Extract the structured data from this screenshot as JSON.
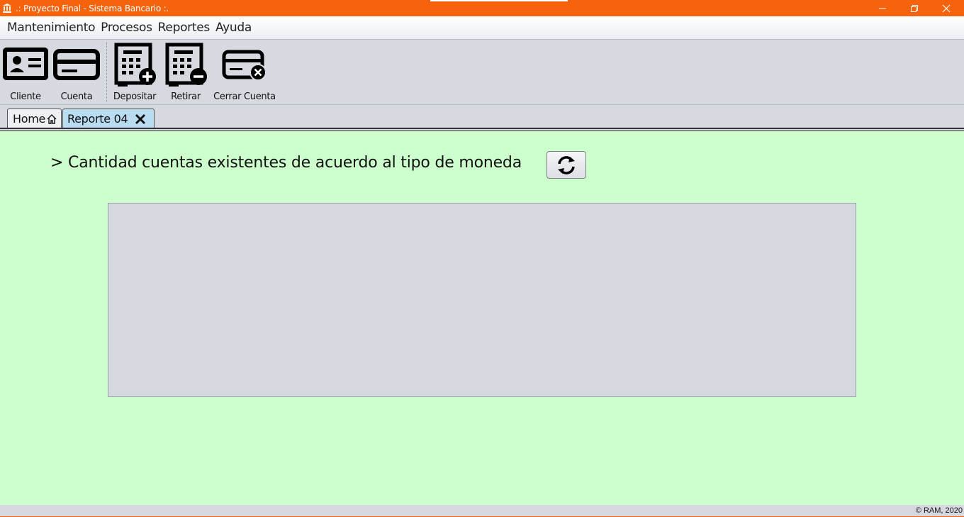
{
  "window": {
    "title": ".: Proyecto Final - Sistema Bancario :.",
    "accent_color": "#f7630c",
    "controls": [
      "minimize-icon",
      "restore-icon",
      "close-icon"
    ]
  },
  "menubar": {
    "items": [
      "Mantenimiento",
      "Procesos",
      "Reportes",
      "Ayuda"
    ]
  },
  "toolbar": {
    "buttons": [
      {
        "label": "Cliente",
        "icon": "id-card-icon"
      },
      {
        "label": "Cuenta",
        "icon": "credit-card-icon"
      },
      {
        "label": "Depositar",
        "icon": "calculator-plus-icon"
      },
      {
        "label": "Retirar",
        "icon": "calculator-minus-icon"
      },
      {
        "label": "Cerrar Cuenta",
        "icon": "card-close-icon"
      }
    ]
  },
  "tabs": [
    {
      "label": "Home",
      "icon": "home-icon",
      "active": false
    },
    {
      "label": "Reporte 04",
      "icon": "close-icon",
      "active": true
    }
  ],
  "report": {
    "heading": "> Cantidad cuentas existentes de acuerdo al tipo de moneda",
    "refresh_icon": "refresh-icon",
    "background_color": "#ccffcc"
  },
  "statusbar": {
    "copyright": "© RAM, 2020"
  }
}
